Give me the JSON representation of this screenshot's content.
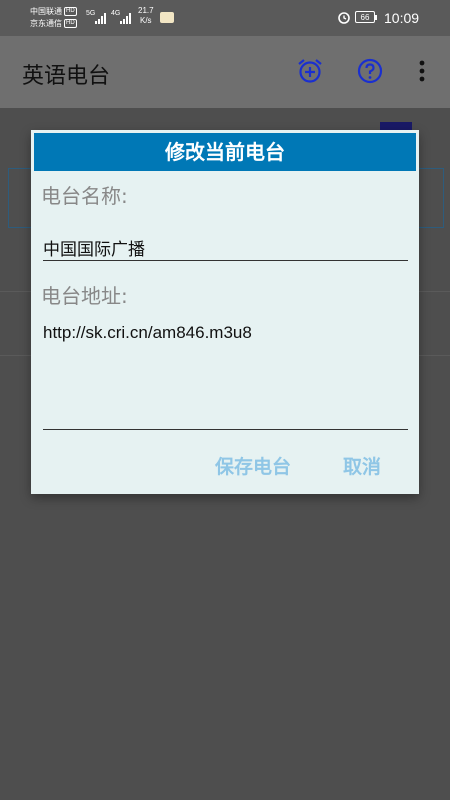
{
  "status": {
    "carrier1": "中国联通",
    "carrier2": "京东通信",
    "hd": "HD",
    "net1": "5G",
    "net2": "4G",
    "speed_value": "21.7",
    "speed_unit": "K/s",
    "battery": "66",
    "time": "10:09"
  },
  "appbar": {
    "title": "英语电台",
    "icons": [
      "alarm-add-icon",
      "help-icon",
      "more-vert-icon"
    ]
  },
  "dialog": {
    "title": "修改当前电台",
    "name_label": "电台名称:",
    "name_value": "中国国际广播",
    "url_label": "电台地址:",
    "url_value": "http://sk.cri.cn/am846.m3u8",
    "save_label": "保存电台",
    "cancel_label": "取消"
  },
  "colors": {
    "dialog_header": "#0078b6",
    "dialog_bg": "#e6f2f2",
    "button_text": "#8fc6e6",
    "app_icon": "#1a2fd0"
  }
}
